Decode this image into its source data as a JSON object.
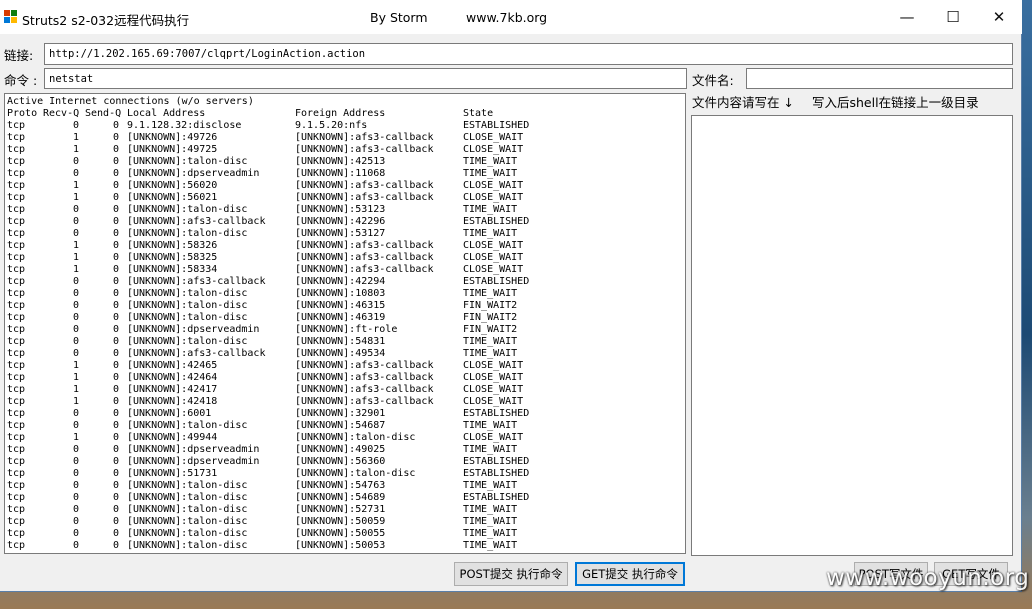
{
  "window": {
    "title": "Struts2 s2-032远程代码执行",
    "author": "By Storm",
    "site": "www.7kb.org",
    "controls": {
      "minimize": "—",
      "maximize": "☐",
      "close": "✕"
    }
  },
  "form": {
    "link_label": "链接:",
    "link_value": "http://1.202.165.69:7007/clqprt/LoginAction.action",
    "command_label": "命令 :",
    "command_value": "netstat",
    "filename_label": "文件名:",
    "filename_value": "",
    "content_hint": "文件内容请写在 ↓",
    "path_hint": "写入后shell在链接上一级目录",
    "file_content": ""
  },
  "output": {
    "intro": "Active Internet connections (w/o servers)",
    "header": {
      "proto": "Proto",
      "recv": "Recv-Q",
      "send": "Send-Q",
      "local": "Local Address",
      "foreign": "Foreign Address",
      "state": "State"
    },
    "rows": [
      [
        "tcp",
        "0",
        "0",
        "9.1.128.32:disclose",
        "9.1.5.20:nfs",
        "ESTABLISHED"
      ],
      [
        "tcp",
        "1",
        "0",
        "[UNKNOWN]:49726",
        "[UNKNOWN]:afs3-callback",
        "CLOSE_WAIT"
      ],
      [
        "tcp",
        "1",
        "0",
        "[UNKNOWN]:49725",
        "[UNKNOWN]:afs3-callback",
        "CLOSE_WAIT"
      ],
      [
        "tcp",
        "0",
        "0",
        "[UNKNOWN]:talon-disc",
        "[UNKNOWN]:42513",
        "TIME_WAIT"
      ],
      [
        "tcp",
        "0",
        "0",
        "[UNKNOWN]:dpserveadmin",
        "[UNKNOWN]:11068",
        "TIME_WAIT"
      ],
      [
        "tcp",
        "1",
        "0",
        "[UNKNOWN]:56020",
        "[UNKNOWN]:afs3-callback",
        "CLOSE_WAIT"
      ],
      [
        "tcp",
        "1",
        "0",
        "[UNKNOWN]:56021",
        "[UNKNOWN]:afs3-callback",
        "CLOSE_WAIT"
      ],
      [
        "tcp",
        "0",
        "0",
        "[UNKNOWN]:talon-disc",
        "[UNKNOWN]:53123",
        "TIME_WAIT"
      ],
      [
        "tcp",
        "0",
        "0",
        "[UNKNOWN]:afs3-callback",
        "[UNKNOWN]:42296",
        "ESTABLISHED"
      ],
      [
        "tcp",
        "0",
        "0",
        "[UNKNOWN]:talon-disc",
        "[UNKNOWN]:53127",
        "TIME_WAIT"
      ],
      [
        "tcp",
        "1",
        "0",
        "[UNKNOWN]:58326",
        "[UNKNOWN]:afs3-callback",
        "CLOSE_WAIT"
      ],
      [
        "tcp",
        "1",
        "0",
        "[UNKNOWN]:58325",
        "[UNKNOWN]:afs3-callback",
        "CLOSE_WAIT"
      ],
      [
        "tcp",
        "1",
        "0",
        "[UNKNOWN]:58334",
        "[UNKNOWN]:afs3-callback",
        "CLOSE_WAIT"
      ],
      [
        "tcp",
        "0",
        "0",
        "[UNKNOWN]:afs3-callback",
        "[UNKNOWN]:42294",
        "ESTABLISHED"
      ],
      [
        "tcp",
        "0",
        "0",
        "[UNKNOWN]:talon-disc",
        "[UNKNOWN]:10803",
        "TIME_WAIT"
      ],
      [
        "tcp",
        "0",
        "0",
        "[UNKNOWN]:talon-disc",
        "[UNKNOWN]:46315",
        "FIN_WAIT2"
      ],
      [
        "tcp",
        "0",
        "0",
        "[UNKNOWN]:talon-disc",
        "[UNKNOWN]:46319",
        "FIN_WAIT2"
      ],
      [
        "tcp",
        "0",
        "0",
        "[UNKNOWN]:dpserveadmin",
        "[UNKNOWN]:ft-role",
        "FIN_WAIT2"
      ],
      [
        "tcp",
        "0",
        "0",
        "[UNKNOWN]:talon-disc",
        "[UNKNOWN]:54831",
        "TIME_WAIT"
      ],
      [
        "tcp",
        "0",
        "0",
        "[UNKNOWN]:afs3-callback",
        "[UNKNOWN]:49534",
        "TIME_WAIT"
      ],
      [
        "tcp",
        "1",
        "0",
        "[UNKNOWN]:42465",
        "[UNKNOWN]:afs3-callback",
        "CLOSE_WAIT"
      ],
      [
        "tcp",
        "1",
        "0",
        "[UNKNOWN]:42464",
        "[UNKNOWN]:afs3-callback",
        "CLOSE_WAIT"
      ],
      [
        "tcp",
        "1",
        "0",
        "[UNKNOWN]:42417",
        "[UNKNOWN]:afs3-callback",
        "CLOSE_WAIT"
      ],
      [
        "tcp",
        "1",
        "0",
        "[UNKNOWN]:42418",
        "[UNKNOWN]:afs3-callback",
        "CLOSE_WAIT"
      ],
      [
        "tcp",
        "0",
        "0",
        "[UNKNOWN]:6001",
        "[UNKNOWN]:32901",
        "ESTABLISHED"
      ],
      [
        "tcp",
        "0",
        "0",
        "[UNKNOWN]:talon-disc",
        "[UNKNOWN]:54687",
        "TIME_WAIT"
      ],
      [
        "tcp",
        "1",
        "0",
        "[UNKNOWN]:49944",
        "[UNKNOWN]:talon-disc",
        "CLOSE_WAIT"
      ],
      [
        "tcp",
        "0",
        "0",
        "[UNKNOWN]:dpserveadmin",
        "[UNKNOWN]:49025",
        "TIME_WAIT"
      ],
      [
        "tcp",
        "0",
        "0",
        "[UNKNOWN]:dpserveadmin",
        "[UNKNOWN]:56360",
        "ESTABLISHED"
      ],
      [
        "tcp",
        "0",
        "0",
        "[UNKNOWN]:51731",
        "[UNKNOWN]:talon-disc",
        "ESTABLISHED"
      ],
      [
        "tcp",
        "0",
        "0",
        "[UNKNOWN]:talon-disc",
        "[UNKNOWN]:54763",
        "TIME_WAIT"
      ],
      [
        "tcp",
        "0",
        "0",
        "[UNKNOWN]:talon-disc",
        "[UNKNOWN]:54689",
        "ESTABLISHED"
      ],
      [
        "tcp",
        "0",
        "0",
        "[UNKNOWN]:talon-disc",
        "[UNKNOWN]:52731",
        "TIME_WAIT"
      ],
      [
        "tcp",
        "0",
        "0",
        "[UNKNOWN]:talon-disc",
        "[UNKNOWN]:50059",
        "TIME_WAIT"
      ],
      [
        "tcp",
        "0",
        "0",
        "[UNKNOWN]:talon-disc",
        "[UNKNOWN]:50055",
        "TIME_WAIT"
      ],
      [
        "tcp",
        "0",
        "0",
        "[UNKNOWN]:talon-disc",
        "[UNKNOWN]:50053",
        "TIME_WAIT"
      ]
    ]
  },
  "buttons": {
    "post_exec": "POST提交 执行命令",
    "get_exec": "GET提交 执行命令",
    "post_write": "POST写文件",
    "get_write": "GET写文件"
  },
  "watermark": "www.wooyun.org",
  "colors": {
    "accent": "#0078d7",
    "window_bg": "#f0f0f0"
  }
}
